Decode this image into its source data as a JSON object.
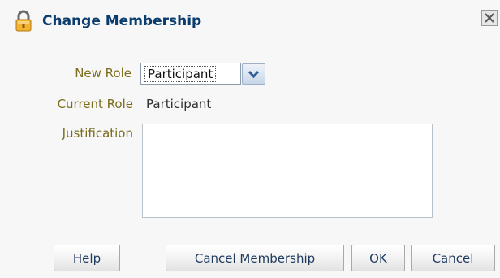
{
  "dialog": {
    "title": "Change Membership",
    "title_icon": "lock-icon",
    "close_icon": "close-icon"
  },
  "form": {
    "new_role_label": "New Role",
    "new_role_value": "Participant",
    "current_role_label": "Current Role",
    "current_role_value": "Participant",
    "justification_label": "Justification",
    "justification_value": ""
  },
  "buttons": {
    "help": "Help",
    "cancel_membership": "Cancel Membership",
    "ok": "OK",
    "cancel": "Cancel"
  },
  "colors": {
    "title": "#0b3c6e",
    "label": "#7a6c1c",
    "button_text": "#1e3a5f"
  }
}
